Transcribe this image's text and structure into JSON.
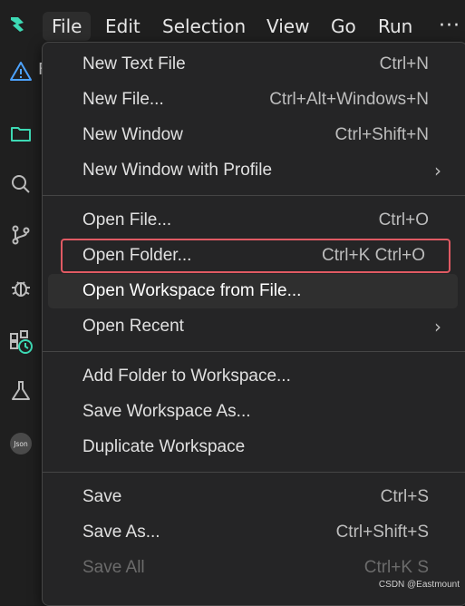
{
  "menubar": {
    "items": [
      {
        "label": "File"
      },
      {
        "label": "Edit"
      },
      {
        "label": "Selection"
      },
      {
        "label": "View"
      },
      {
        "label": "Go"
      },
      {
        "label": "Run"
      }
    ],
    "more": "···"
  },
  "activitybar": {
    "icons": [
      "warning-icon",
      "explorer-icon",
      "search-icon",
      "source-control-icon",
      "debug-icon",
      "extensions-icon",
      "testing-icon",
      "json-icon"
    ],
    "json_label": "Json"
  },
  "partial_text": "F",
  "file_menu": {
    "groups": [
      [
        {
          "label": "New Text File",
          "shortcut": "Ctrl+N"
        },
        {
          "label": "New File...",
          "shortcut": "Ctrl+Alt+Windows+N"
        },
        {
          "label": "New Window",
          "shortcut": "Ctrl+Shift+N"
        },
        {
          "label": "New Window with Profile",
          "shortcut": ""
        }
      ],
      [
        {
          "label": "Open File...",
          "shortcut": "Ctrl+O"
        },
        {
          "label": "Open Folder...",
          "shortcut": "Ctrl+K Ctrl+O"
        },
        {
          "label": "Open Workspace from File...",
          "shortcut": ""
        },
        {
          "label": "Open Recent",
          "shortcut": ""
        }
      ],
      [
        {
          "label": "Add Folder to Workspace...",
          "shortcut": ""
        },
        {
          "label": "Save Workspace As...",
          "shortcut": ""
        },
        {
          "label": "Duplicate Workspace",
          "shortcut": ""
        }
      ],
      [
        {
          "label": "Save",
          "shortcut": "Ctrl+S"
        },
        {
          "label": "Save As...",
          "shortcut": "Ctrl+Shift+S"
        },
        {
          "label": "Save All",
          "shortcut": "Ctrl+K S"
        }
      ]
    ],
    "submenu_arrow": "›"
  },
  "colors": {
    "background": "#1f1f1f",
    "menu_bg": "#252526",
    "highlight_outline": "#e05a63",
    "accent": "#3dd9b4"
  },
  "watermark": "CSDN @Eastmount"
}
